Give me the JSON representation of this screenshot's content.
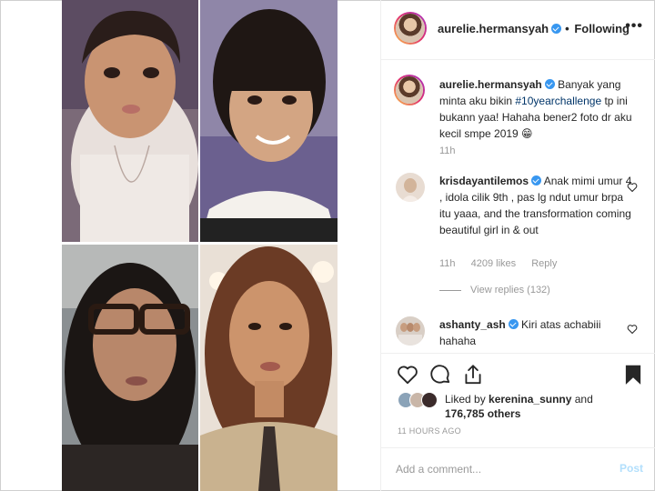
{
  "header": {
    "username": "aurelie.hermansyah",
    "separator": "•",
    "follow_status": "Following",
    "more_label": "•••"
  },
  "caption": {
    "username": "aurelie.hermansyah",
    "text_before": " Banyak yang minta aku bikin ",
    "hashtag": "#10yearchallenge",
    "text_after": " tp ini bukann yaa! Hahaha bener2 foto dr aku kecil smpe 2019 😁",
    "time": "11h"
  },
  "comments": [
    {
      "username": "krisdayantilemos",
      "text": " Anak mimi umur 4 , idola cilik 9th , pas lg ndut umur brpa itu yaaa, and the transformation coming beautiful girl in & out",
      "time": "11h",
      "likes": "4209 likes",
      "reply_label": "Reply",
      "view_replies": "View replies (132)"
    },
    {
      "username": "ashanty_ash",
      "text": " Kiri atas achabiii hahaha"
    }
  ],
  "likes": {
    "prefix": "Liked by ",
    "user": "kerenina_sunny",
    "middle": " and",
    "count": "176,785 others"
  },
  "timestamp": "11 HOURS AGO",
  "add_comment": {
    "placeholder": "Add a comment...",
    "post_label": "Post"
  },
  "icons": {
    "like": "heart-icon",
    "comment": "comment-icon",
    "share": "share-icon",
    "save": "bookmark-icon",
    "verified": "verified-badge-icon",
    "more": "more-options-icon"
  },
  "colors": {
    "verified_blue": "#3897f0",
    "hashtag": "#003569",
    "muted": "#999999",
    "post_button_disabled": "#b2dffc",
    "text": "#262626"
  }
}
